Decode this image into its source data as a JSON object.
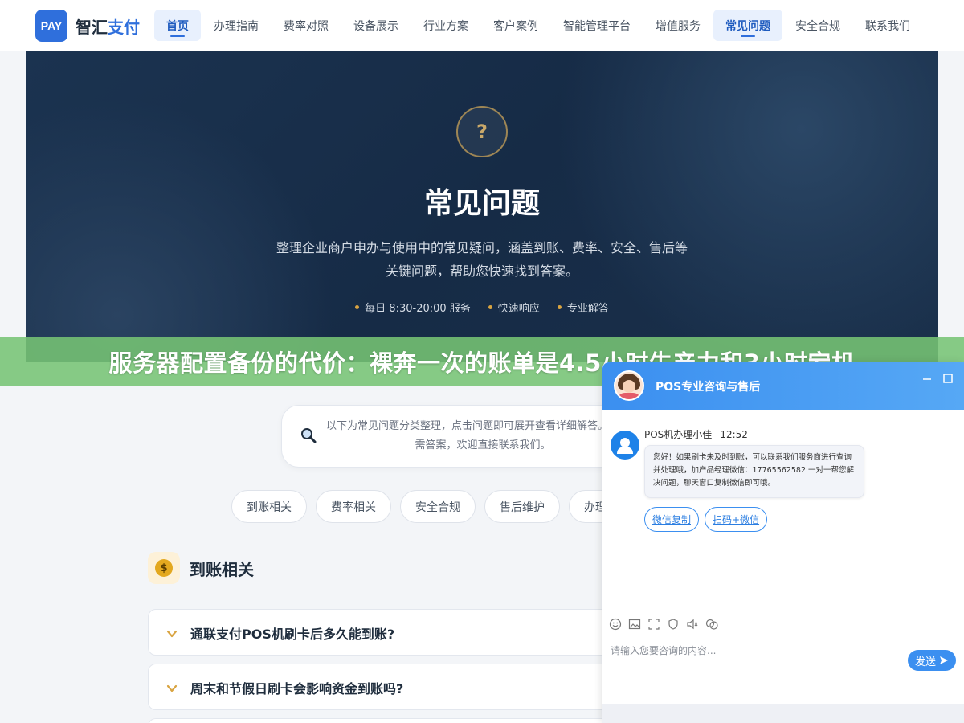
{
  "header": {
    "logo_badge": "PAY",
    "logo_name": "智汇",
    "logo_accent": "支付",
    "nav": [
      {
        "label": "首页",
        "active": true
      },
      {
        "label": "办理指南"
      },
      {
        "label": "费率对照"
      },
      {
        "label": "设备展示"
      },
      {
        "label": "行业方案"
      },
      {
        "label": "客户案例"
      },
      {
        "label": "智能管理平台"
      },
      {
        "label": "增值服务"
      },
      {
        "label": "常见问题",
        "active": true
      },
      {
        "label": "安全合规"
      },
      {
        "label": "联系我们"
      }
    ]
  },
  "hero": {
    "icon_symbol": "?",
    "title": "常见问题",
    "subtitle": "整理企业商户申办与使用中的常见疑问，涵盖到账、费率、安全、售后等关键问题，帮助您快速找到答案。",
    "tags": [
      "每日 8:30-20:00 服务",
      "快速响应",
      "专业解答"
    ]
  },
  "banner": {
    "text": "服务器配置备份的代价：裸奔一次的账单是4.5小时生产力和3小时宕机"
  },
  "search": {
    "text": "以下为常见问题分类整理，点击问题即可展开查看详细解答。找到所需答案，欢迎直接联系我们。"
  },
  "categories": [
    "到账相关",
    "费率相关",
    "安全合规",
    "售后维护",
    "办理"
  ],
  "section": {
    "icon": "coin-icon",
    "icon_symbol": "$",
    "title": "到账相关"
  },
  "faqs": [
    {
      "question": "通联支付POS机刷卡后多久能到账?"
    },
    {
      "question": "周末和节假日刷卡会影响资金到账吗?"
    },
    {
      "question": ""
    }
  ],
  "chat": {
    "title": "POS专业咨询与售后",
    "agent_name": "POS机办理小佳",
    "time": "12:52",
    "message": "您好！如果刷卡未及时到账，可以联系我们服务商进行查询并处理哦，加产品经理微信：17765562582 一对一帮您解决问题，聊天窗口复制微信即可哦。",
    "buttons": [
      "微信复制",
      "扫码+微信"
    ],
    "toolbar_icons": [
      "emoji-icon",
      "image-icon",
      "screenshot-icon",
      "rate-icon",
      "voice-icon",
      "history-icon"
    ],
    "input_placeholder": "请输入您要咨询的内容...",
    "send_label": "发送"
  },
  "colors": {
    "brand": "#2f6fdc",
    "hero_bg": "#1b3350",
    "banner_bg": "#76c474",
    "chat_header": "#3b8ff0",
    "accent_gold": "#d9a441"
  }
}
